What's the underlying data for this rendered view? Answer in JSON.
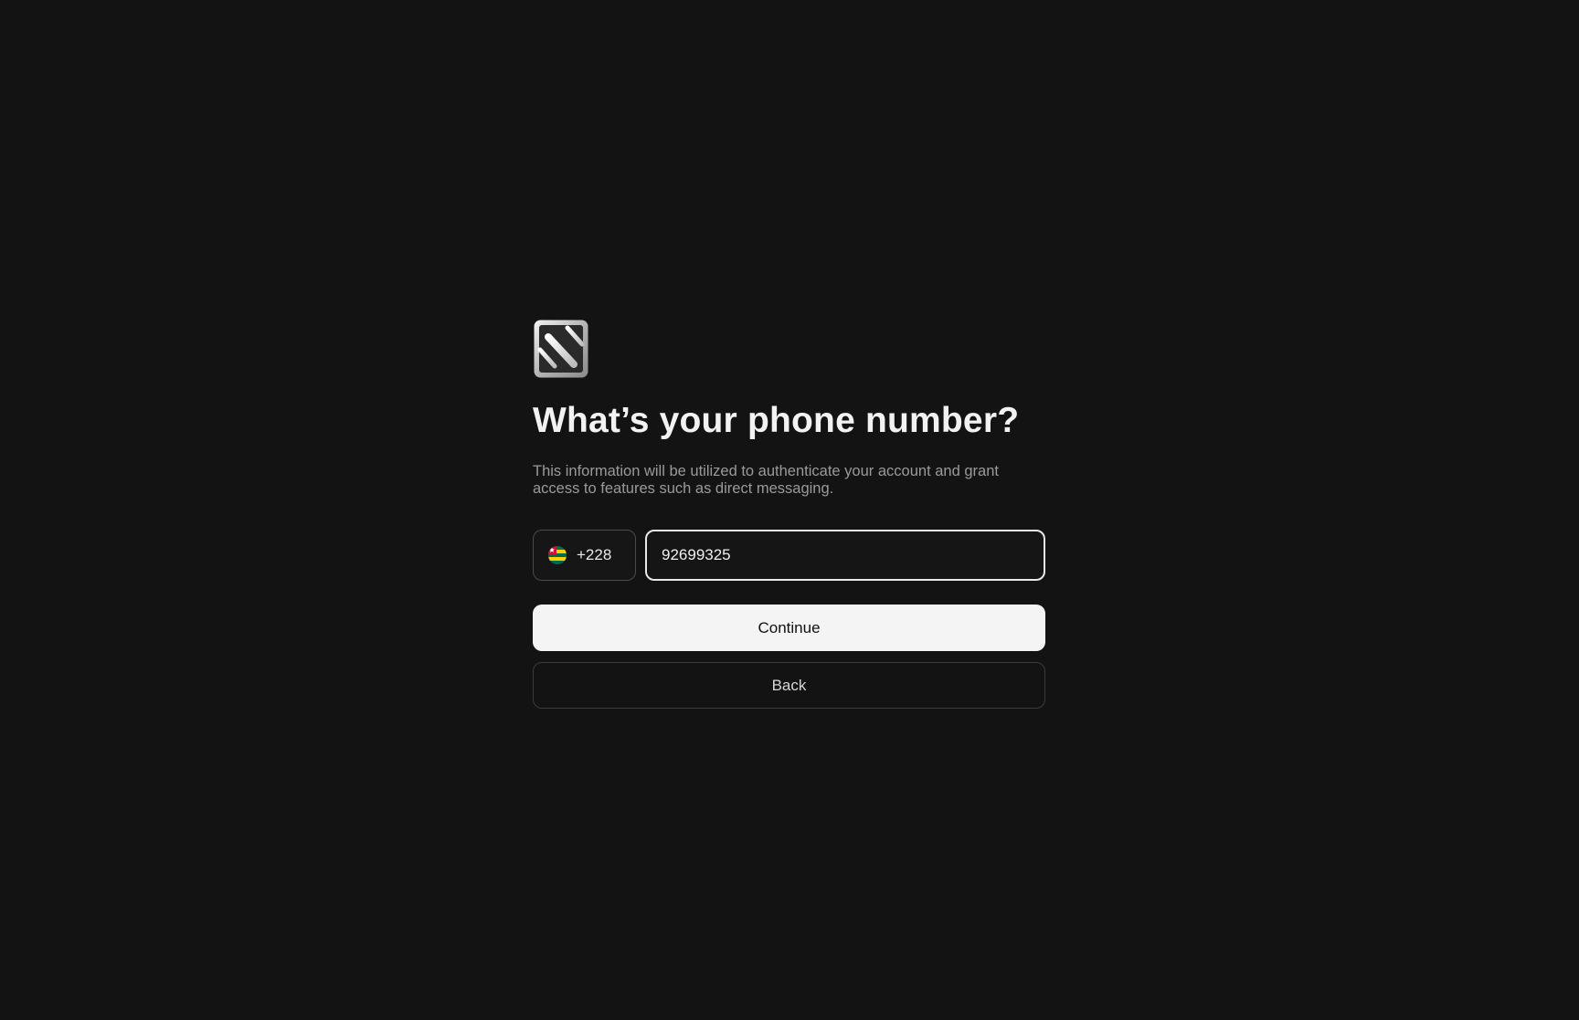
{
  "logo": {
    "icon": "slash-square-logo-icon"
  },
  "heading": {
    "title": "What’s your phone number?"
  },
  "description": "This information will be utilized to authenticate your account and grant access to features such as direct messaging.",
  "phone": {
    "country_flag_icon": "togo-flag-icon",
    "dial_code": "+228",
    "number_value": "92699325"
  },
  "actions": {
    "continue_label": "Continue",
    "back_label": "Back"
  },
  "colors": {
    "background": "#131313",
    "primary_button": "#f4f4f4",
    "text_primary": "#f2f2f2",
    "text_secondary": "#9a9a9a"
  }
}
